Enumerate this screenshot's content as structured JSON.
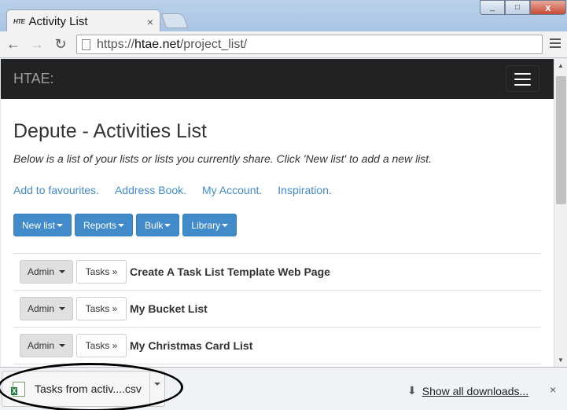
{
  "tab": {
    "favicon_text": "HTE",
    "title": "Activity List",
    "close_glyph": "×"
  },
  "window_controls": {
    "minimize": "_",
    "maximize": "□",
    "close": "x"
  },
  "toolbar": {
    "back_glyph": "←",
    "forward_glyph": "→",
    "reload_glyph": "↻",
    "url_scheme": "https://",
    "url_host": "htae.net",
    "url_path": "/project_list/"
  },
  "navbar": {
    "brand": "HTAE:"
  },
  "main": {
    "title": "Depute - Activities List",
    "lead": "Below is a list of your lists or lists you currently share. Click 'New list' to add a new list.",
    "links": [
      "Add to favourites.",
      "Address Book.",
      "My Account.",
      "Inspiration."
    ],
    "buttons": [
      "New list",
      "Reports",
      "Bulk",
      "Library"
    ]
  },
  "list": {
    "admin_label": "Admin",
    "tasks_label": "Tasks »",
    "rows": [
      {
        "title": "Create A Task List Template Web Page"
      },
      {
        "title": "My Bucket List"
      },
      {
        "title": "My Christmas Card List"
      }
    ]
  },
  "downloads": {
    "file_name": "Tasks from activ....csv",
    "show_all": "Show all downloads...",
    "close_glyph": "×",
    "arrow_glyph": "⬇"
  },
  "colors": {
    "primary": "#428bca",
    "navbar": "#222222",
    "link": "#428bca"
  }
}
